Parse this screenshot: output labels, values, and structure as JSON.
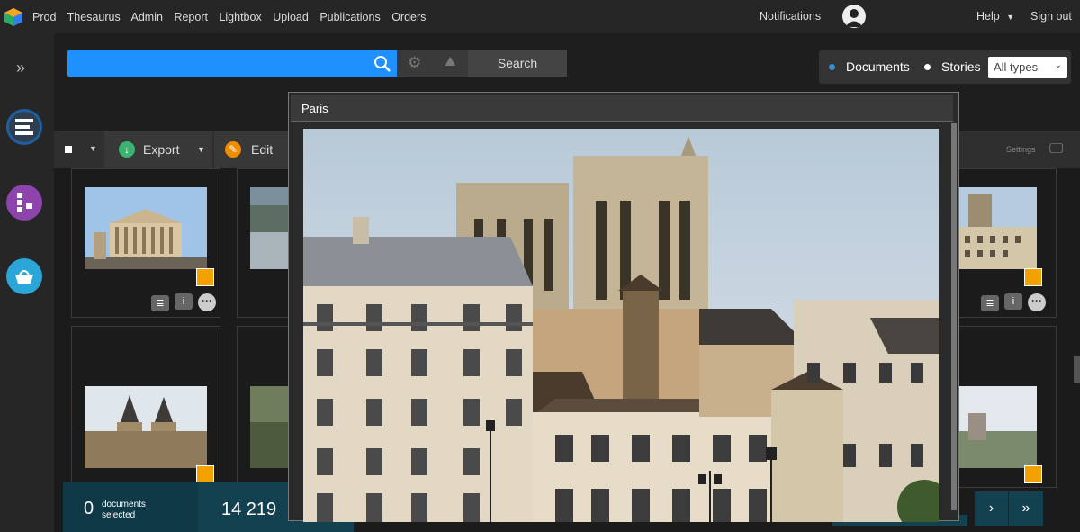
{
  "topbar": {
    "nav": [
      "Prod",
      "Thesaurus",
      "Admin",
      "Report",
      "Lightbox",
      "Upload",
      "Publications",
      "Orders"
    ],
    "notifications": "Notifications",
    "help": "Help",
    "sign_out": "Sign out"
  },
  "search": {
    "button": "Search",
    "filters": {
      "documents": "Documents",
      "stories": "Stories",
      "types_selected": "All types"
    }
  },
  "actions": {
    "export": "Export",
    "edit": "Edit",
    "settings": "Settings"
  },
  "footer": {
    "selected_count": "0",
    "selected_label_1": "documents",
    "selected_label_2": "selected",
    "total": "14 219"
  },
  "preview": {
    "title": "Paris"
  },
  "colors": {
    "accent": "#1e90ff",
    "badge": "#f2a100",
    "bar": "#14414f"
  }
}
